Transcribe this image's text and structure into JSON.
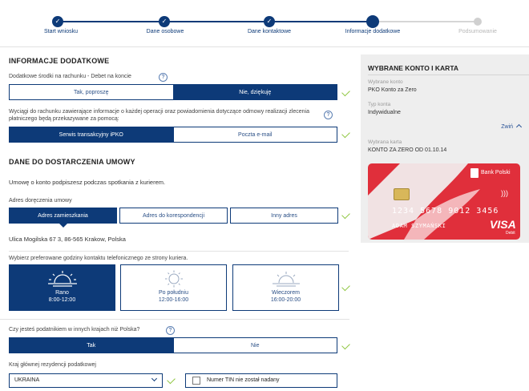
{
  "stepper": {
    "steps": [
      {
        "label": "Start wniosku",
        "state": "done"
      },
      {
        "label": "Dane osobowe",
        "state": "done"
      },
      {
        "label": "Dane kontaktowe",
        "state": "done"
      },
      {
        "label": "Informacje dodatkowe",
        "state": "current"
      },
      {
        "label": "Podsumowanie",
        "state": "future"
      }
    ],
    "done_mark": "✓"
  },
  "additional": {
    "heading": "INFORMACJE DODATKOWE",
    "debit_label": "Dodatkowe środki na rachunku - Debet na koncie",
    "debit_options": [
      "Tak, poproszę",
      "Nie, dziękuję"
    ],
    "consent_label": "Wyciągi do rachunku zawierające informacje o każdej operacji oraz powiadomienia dotyczące odmowy realizacji zlecenia płatniczego będą przekazywane za pomocą:",
    "consent_options": [
      "Serwis transakcyjny iPKO",
      "Poczta e-mail"
    ],
    "help_glyph": "?"
  },
  "delivery": {
    "heading": "DANE DO DOSTARCZENIA UMOWY",
    "intro": "Umowę o konto podpiszesz podczas spotkania z kurierem.",
    "address_label": "Adres doręczenia umowy",
    "address_options": [
      "Adres zamieszkania",
      "Adres do korespondencji",
      "Inny adres"
    ],
    "address_value": "Ulica Mogilska 67  3, 86-565 Krakow, Polska",
    "hours_label": "Wybierz preferowane godziny kontaktu telefonicznego ze strony kuriera.",
    "hours": [
      {
        "name": "Rano",
        "time": "8:00-12:00"
      },
      {
        "name": "Po południu",
        "time": "12:00-16:00"
      },
      {
        "name": "Wieczorem",
        "time": "16:00-20:00"
      }
    ]
  },
  "tax": {
    "question": "Czy jesteś podatnikiem w innych krajach niż Polska?",
    "options": [
      "Tak",
      "Nie"
    ],
    "country_label": "Kraj głównej rezydencji podatkowej",
    "country_value": "UKRAINA",
    "tin_label": "Numer TIN nie został nadany"
  },
  "summary": {
    "title": "WYBRANE KONTO I KARTA",
    "account_label": "Wybrane konto",
    "account_value": "PKO Konto za Zero",
    "type_label": "Typ konta",
    "type_value": "Indywidualne",
    "collapse_label": "Zwiń",
    "card_label": "Wybrana karta",
    "card_value": "KONTO ZA ZERO OD 01.10.14",
    "card": {
      "bank": "Bank Polski",
      "number": "1234  5678  9012  3456",
      "holder": "ADAM SZYMAŃSKI",
      "brand": "VISA",
      "brand_sub": "Debit"
    }
  },
  "colors": {
    "primary": "#0d3a78",
    "check": "#8ec63f",
    "card_red": "#e02f3b",
    "panel_bg": "#eeeeee"
  }
}
